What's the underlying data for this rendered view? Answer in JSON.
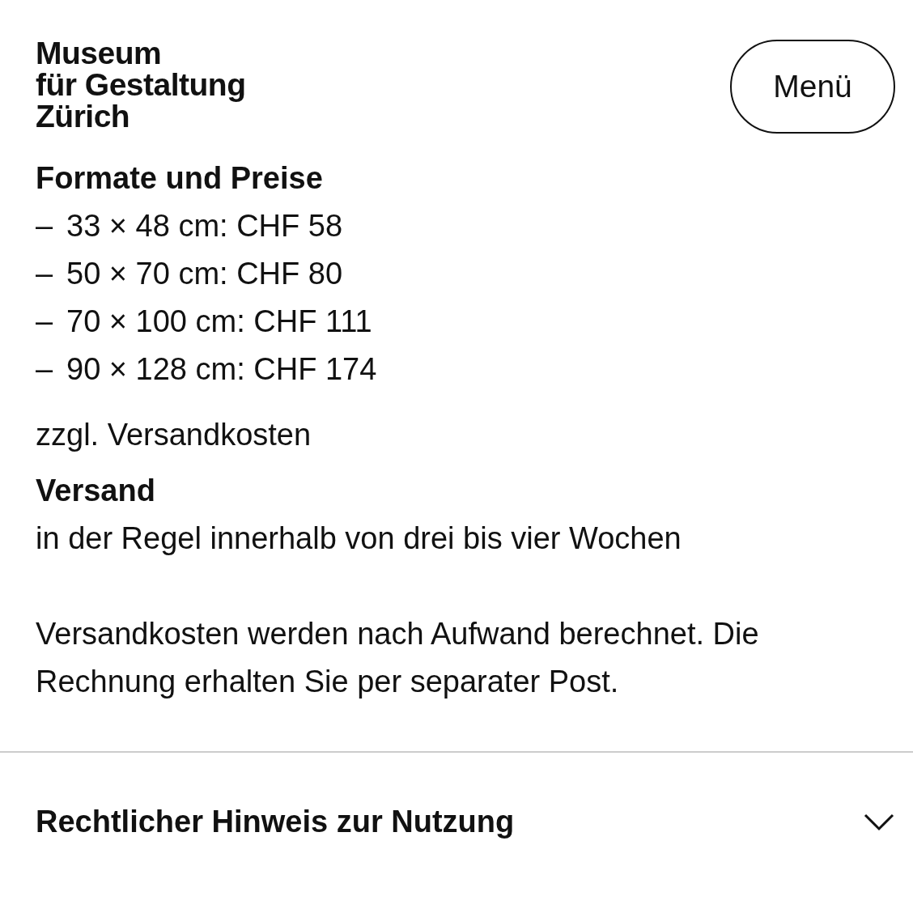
{
  "logo": {
    "lines": [
      "Museum",
      "für Gestaltung",
      "Zürich"
    ]
  },
  "menu_button": {
    "label": "Menü"
  },
  "content": [
    {
      "kind": "heading",
      "text": "Formate und Preise"
    },
    {
      "kind": "list",
      "items": [
        {
          "marker": "–",
          "text": "33 × 48 cm: CHF 58"
        },
        {
          "marker": "–",
          "text": "50 × 70 cm: CHF 80"
        },
        {
          "marker": "–",
          "text": "70 × 100 cm: CHF 111"
        },
        {
          "marker": "–",
          "text": "90 × 128 cm: CHF 174"
        }
      ]
    },
    {
      "kind": "paragraph",
      "text": "zzgl. Versandkosten"
    },
    {
      "kind": "heading",
      "text": "Versand"
    },
    {
      "kind": "text",
      "text": "in der Regel innerhalb von drei bis vier Wochen"
    },
    {
      "kind": "paragraph",
      "text": "Versandkosten werden nach Aufwand berechnet. Die Rechnung erhalten Sie per separater Post."
    }
  ],
  "accordion": {
    "title": "Rechtlicher Hinweis zur Nutzung",
    "expanded": false
  }
}
